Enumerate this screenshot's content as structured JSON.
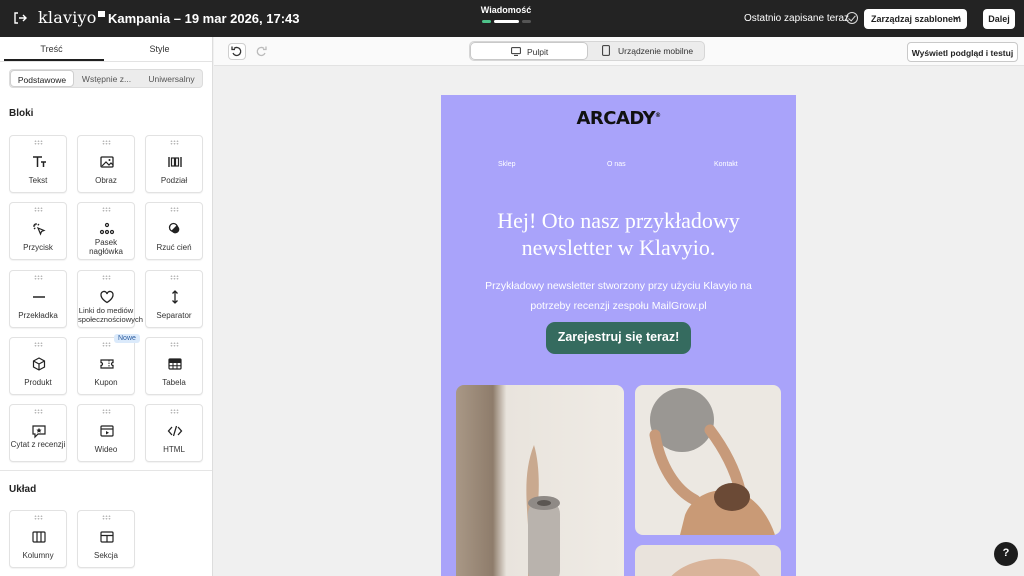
{
  "topbar": {
    "logo": "klaviyo",
    "campaign_title": "Kampania – 19 mar 2026, 17:43",
    "step_label": "Wiadomość",
    "saved_status": "Ostatnio zapisane teraz",
    "manage_templates": "Zarządzaj szablonem",
    "next": "Dalej"
  },
  "sidebar": {
    "tabs": [
      "Treść",
      "Style"
    ],
    "segments": [
      "Podstawowe",
      "Wstępnie z...",
      "Uniwersalny"
    ],
    "blocks_title": "Bloki",
    "blocks": [
      {
        "label": "Tekst",
        "icon": "text-icon"
      },
      {
        "label": "Obraz",
        "icon": "image-icon"
      },
      {
        "label": "Podział",
        "icon": "split-icon"
      },
      {
        "label": "Przycisk",
        "icon": "cursor-click-icon"
      },
      {
        "label": "Pasek nagłówka",
        "icon": "header-bar-icon"
      },
      {
        "label": "Rzuć cień",
        "icon": "shadow-icon"
      },
      {
        "label": "Przekładka",
        "icon": "divider-icon"
      },
      {
        "label": "Linki do mediów społecznościowych",
        "icon": "heart-icon"
      },
      {
        "label": "Separator",
        "icon": "spacer-icon"
      },
      {
        "label": "Produkt",
        "icon": "box-icon"
      },
      {
        "label": "Kupon",
        "icon": "coupon-icon"
      },
      {
        "label": "Tabela",
        "icon": "table-icon"
      },
      {
        "label": "Cytat z recenzji",
        "icon": "quote-icon"
      },
      {
        "label": "Wideo",
        "icon": "video-icon"
      },
      {
        "label": "HTML",
        "icon": "code-icon"
      }
    ],
    "new_badge": "Nowe",
    "layout_title": "Układ",
    "layout": [
      {
        "label": "Kolumny",
        "icon": "columns-icon"
      },
      {
        "label": "Sekcja",
        "icon": "section-icon"
      }
    ]
  },
  "toolbar": {
    "desktop": "Pulpit",
    "mobile": "Urządzenie mobilne",
    "preview": "Wyświetl podgląd i testuj"
  },
  "email": {
    "brand": "ARCADY",
    "nav": [
      "Sklep",
      "O nas",
      "Kontakt"
    ],
    "headline": "Hej! Oto nasz przykładowy newsletter w Klavyio.",
    "body": "Przykładowy newsletter stworzony przy użyciu Klavyio na potrzeby recenzji zespołu MailGrow.pl",
    "cta": "Zarejestruj się teraz!",
    "background": "#a9a3fa",
    "cta_color": "#356b5f"
  },
  "help": "?"
}
